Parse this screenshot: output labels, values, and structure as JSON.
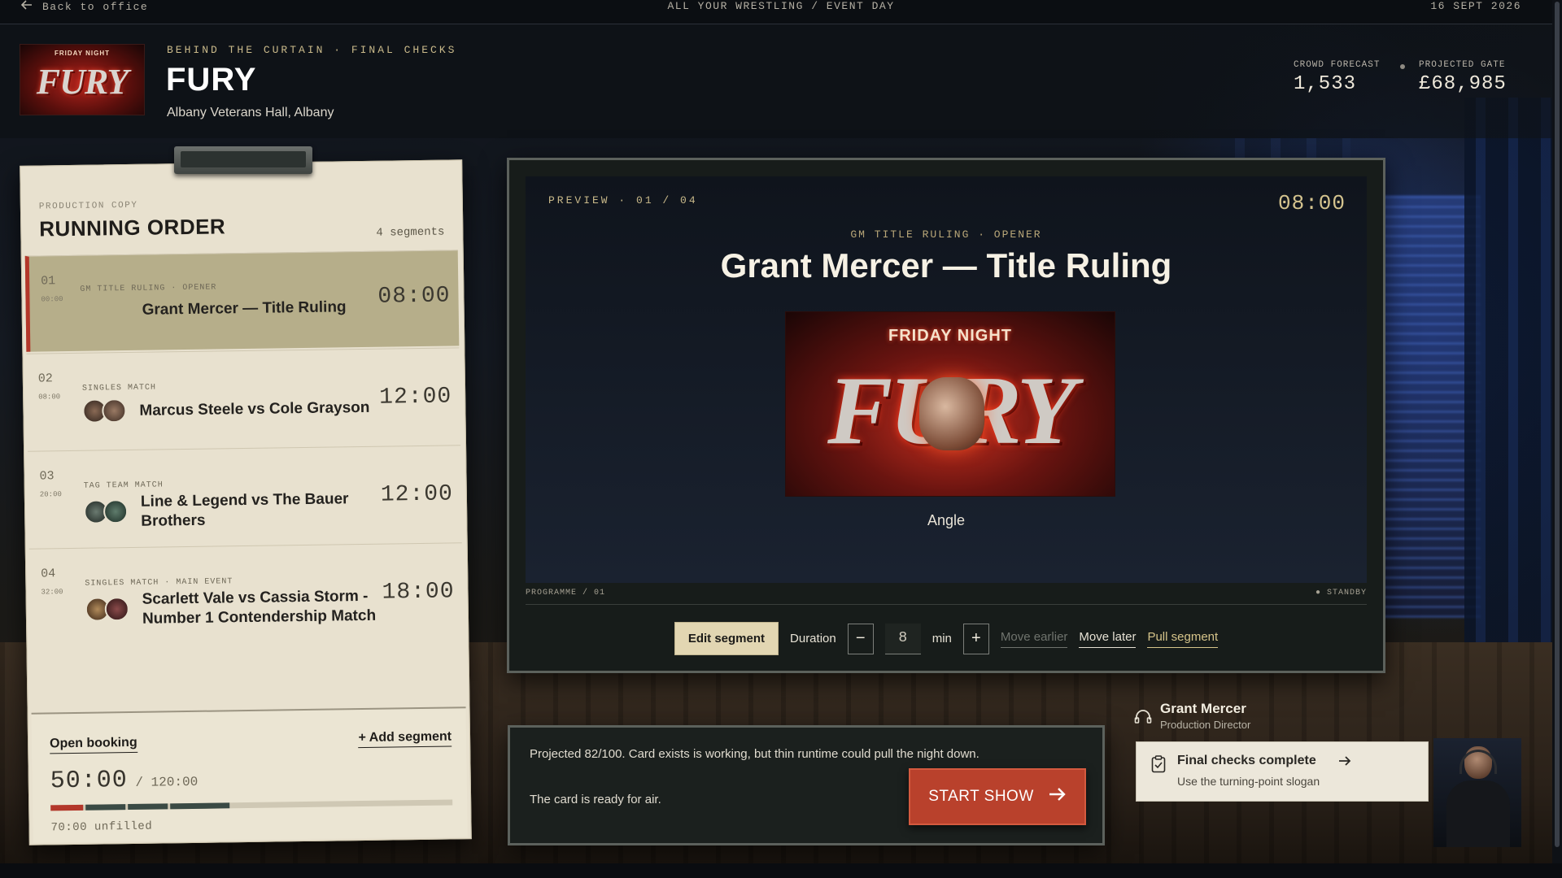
{
  "topbar": {
    "back_label": "Back to office",
    "center_label": "ALL YOUR WRESTLING / EVENT DAY",
    "date": "16 SEPT 2026"
  },
  "header": {
    "logo_top": "FRIDAY NIGHT",
    "logo_main": "FURY",
    "eyebrow": "BEHIND THE CURTAIN · FINAL CHECKS",
    "title": "FURY",
    "venue": "Albany Veterans Hall, Albany",
    "stats": [
      {
        "label": "CROWD FORECAST",
        "value": "1,533"
      },
      {
        "label": "PROJECTED GATE",
        "value": "£68,985"
      }
    ]
  },
  "running_order": {
    "subtitle": "PRODUCTION COPY",
    "title": "RUNNING ORDER",
    "count": "4 segments",
    "segments": [
      {
        "num": "01",
        "start": "00:00",
        "kicker": "GM TITLE RULING · OPENER",
        "name": "Grant Mercer — Title Ruling",
        "duration": "08:00",
        "active": true
      },
      {
        "num": "02",
        "start": "08:00",
        "kicker": "SINGLES MATCH",
        "name": "Marcus Steele vs Cole Grayson",
        "duration": "12:00"
      },
      {
        "num": "03",
        "start": "20:00",
        "kicker": "TAG TEAM MATCH",
        "name": "Line & Legend vs The Bauer Brothers",
        "duration": "12:00"
      },
      {
        "num": "04",
        "start": "32:00",
        "kicker": "SINGLES MATCH · MAIN EVENT",
        "name": "Scarlett Vale vs Cassia Storm - Number 1 Contendership Match",
        "duration": "18:00"
      }
    ],
    "footer": {
      "open_booking": "Open booking",
      "add_segment": "+ Add segment",
      "runtime": "50:00",
      "runtime_total": "/ 120:00",
      "unfilled": "70:00 unfilled",
      "fill_fraction": 0.4167
    }
  },
  "preview": {
    "label": "PREVIEW · 01 / 04",
    "time": "08:00",
    "kicker": "GM TITLE RULING · OPENER",
    "title": "Grant Mercer — Title Ruling",
    "poster_top": "FRIDAY NIGHT",
    "poster_main": "FURY",
    "type": "Angle",
    "strip_left": "PROGRAMME / 01",
    "strip_right": "● STANDBY",
    "controls": {
      "edit": "Edit segment",
      "duration_label": "Duration",
      "minus": "−",
      "duration_value": "8",
      "unit": "min",
      "plus": "+",
      "move_earlier": "Move earlier",
      "move_later": "Move later",
      "pull": "Pull segment"
    }
  },
  "status": {
    "projection": "Projected 82/100. Card exists is working, but thin runtime could pull the night down.",
    "ready": "The card is ready for air.",
    "start_label": "START SHOW"
  },
  "director": {
    "name": "Grant Mercer",
    "role": "Production Director",
    "note_title": "Final checks complete",
    "note_sub": "Use the turning-point slogan"
  },
  "colors": {
    "accent_red": "#b9412c",
    "gold": "#c9b98a",
    "paper": "#e8e1cf"
  }
}
